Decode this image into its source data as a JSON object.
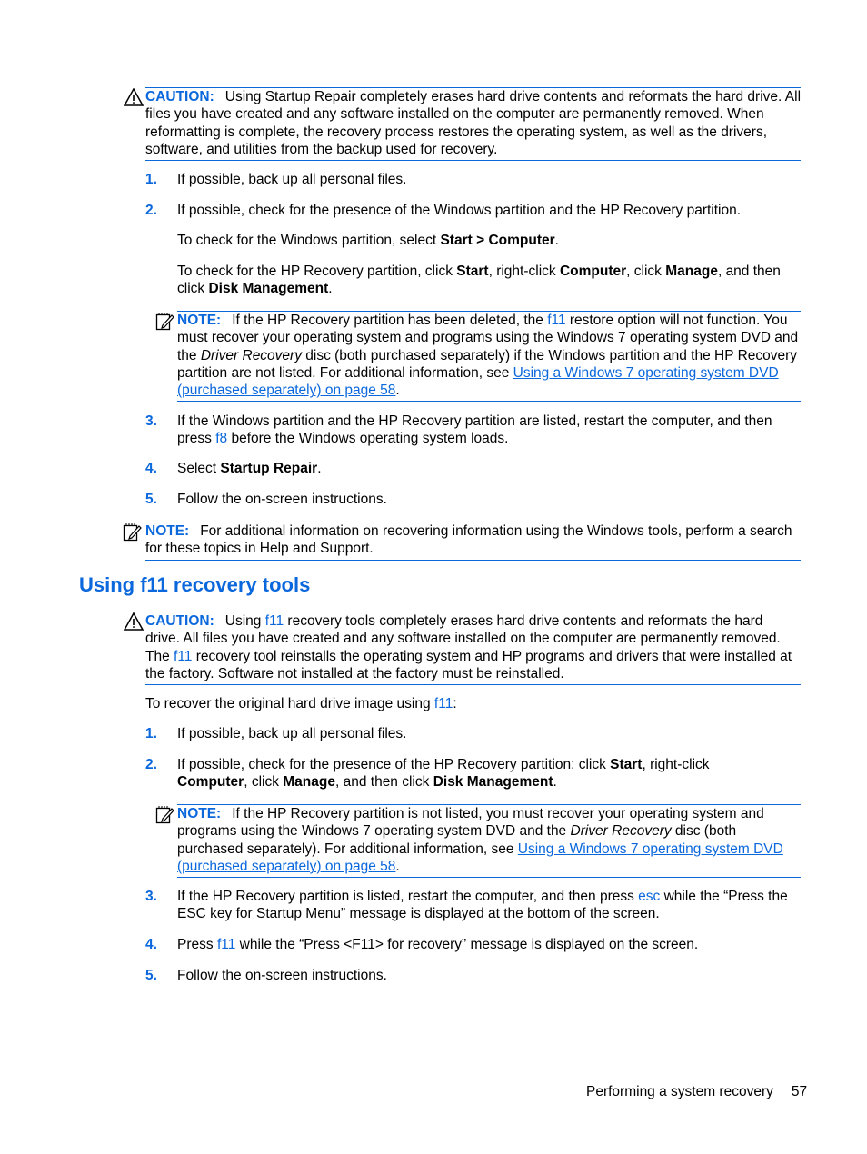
{
  "caution1": {
    "label": "CAUTION:",
    "text": "Using Startup Repair completely erases hard drive contents and reformats the hard drive. All files you have created and any software installed on the computer are permanently removed. When reformatting is complete, the recovery process restores the operating system, as well as the drivers, software, and utilities from the backup used for recovery."
  },
  "steps1": [
    {
      "num": "1.",
      "text": "If possible, back up all personal files."
    },
    {
      "num": "2.",
      "text": "If possible, check for the presence of the Windows partition and the HP Recovery partition."
    },
    {
      "num": "3.",
      "pre": "If the Windows partition and the HP Recovery partition are listed, restart the computer, and then press ",
      "key": "f8",
      "post": " before the Windows operating system loads."
    },
    {
      "num": "4.",
      "pre": "Select ",
      "bold": "Startup Repair",
      "post": "."
    },
    {
      "num": "5.",
      "text": "Follow the on-screen instructions."
    }
  ],
  "sub1": {
    "pre": "To check for the Windows partition, select ",
    "bold": "Start > Computer",
    "post": "."
  },
  "sub2": {
    "a": "To check for the HP Recovery partition, click ",
    "b1": "Start",
    "c": ", right-click ",
    "b2": "Computer",
    "d": ", click ",
    "b3": "Manage",
    "e": ", and then click ",
    "b4": "Disk Management",
    "f": "."
  },
  "note1": {
    "label": "NOTE:",
    "pre": "If the HP Recovery partition has been deleted, the ",
    "key": "f11",
    "mid": " restore option will not function. You must recover your operating system and programs using the Windows 7 operating system DVD and the ",
    "italic": "Driver Recovery",
    "post": " disc (both purchased separately) if the Windows partition and the HP Recovery partition are not listed. For additional information, see ",
    "link": "Using a Windows 7 operating system DVD (purchased separately) on page 58",
    "end": "."
  },
  "note2": {
    "label": "NOTE:",
    "text": "For additional information on recovering information using the Windows tools, perform a search for these topics in Help and Support."
  },
  "heading": "Using f11 recovery tools",
  "caution2": {
    "label": "CAUTION:",
    "a": "Using ",
    "k1": "f11",
    "b": " recovery tools completely erases hard drive contents and reformats the hard drive. All files you have created and any software installed on the computer are permanently removed. The ",
    "k2": "f11",
    "c": " recovery tool reinstalls the operating system and HP programs and drivers that were installed at the factory. Software not installed at the factory must be reinstalled."
  },
  "intro2": {
    "pre": "To recover the original hard drive image using ",
    "key": "f11",
    "post": ":"
  },
  "steps2": [
    {
      "num": "1.",
      "text": "If possible, back up all personal files."
    },
    {
      "num": "2.",
      "a": "If possible, check for the presence of the HP Recovery partition: click ",
      "b1": "Start",
      "c": ", right-click ",
      "b2": "Computer",
      "d": ", click ",
      "b3": "Manage",
      "e": ", and then click ",
      "b4": "Disk Management",
      "f": "."
    },
    {
      "num": "3.",
      "pre": "If the HP Recovery partition is listed, restart the computer, and then press ",
      "key": "esc",
      "post": " while the “Press the ESC key for Startup Menu” message is displayed at the bottom of the screen."
    },
    {
      "num": "4.",
      "pre": "Press ",
      "key": "f11",
      "post": " while the “Press <F11> for recovery” message is displayed on the screen."
    },
    {
      "num": "5.",
      "text": "Follow the on-screen instructions."
    }
  ],
  "note3": {
    "label": "NOTE:",
    "pre": "If the HP Recovery partition is not listed, you must recover your operating system and programs using the Windows 7 operating system DVD and the ",
    "italic": "Driver Recovery",
    "post": " disc (both purchased separately). For additional information, see ",
    "link": "Using a Windows 7 operating system DVD (purchased separately) on page 58",
    "end": "."
  },
  "footer": {
    "title": "Performing a system recovery",
    "page": "57"
  }
}
